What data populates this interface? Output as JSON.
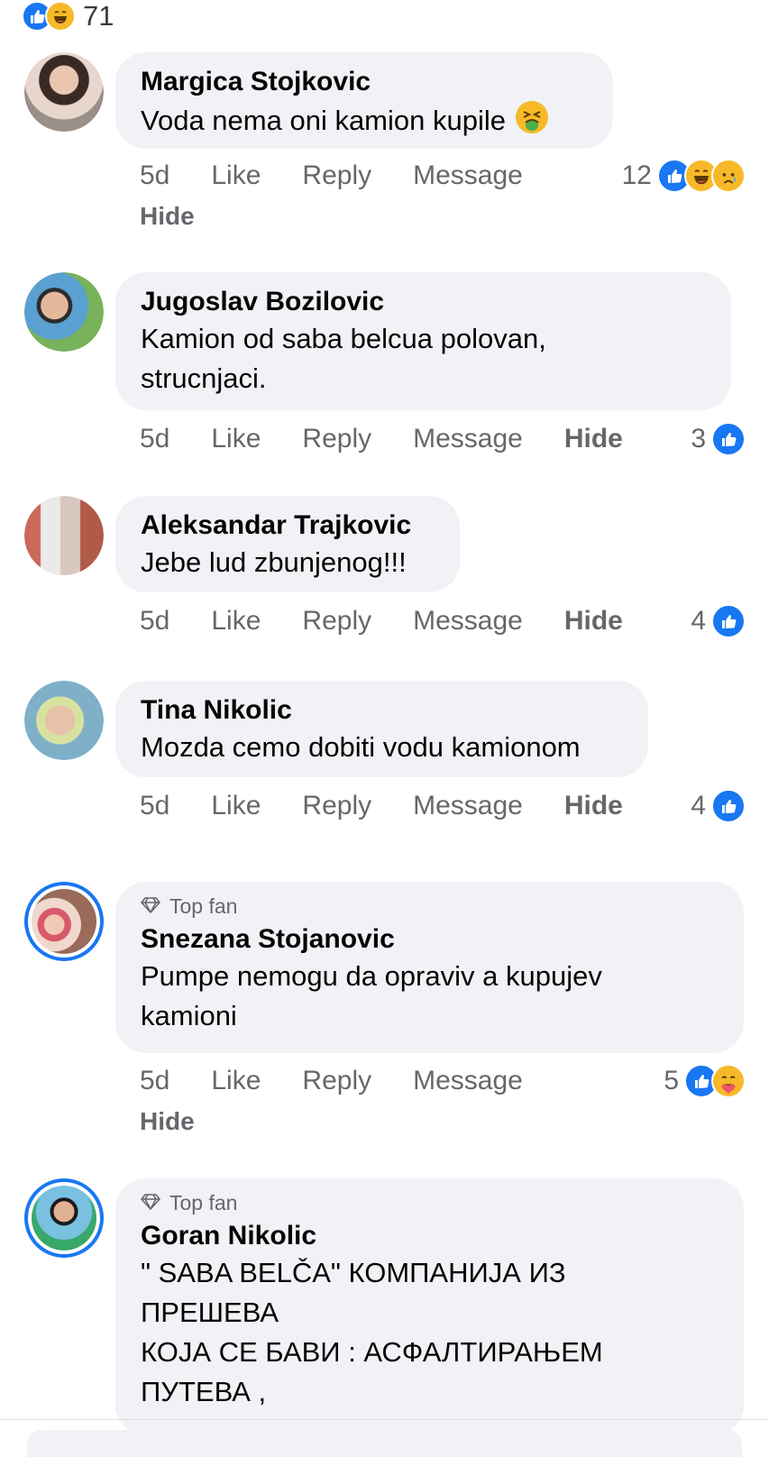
{
  "top": {
    "count": "71",
    "reactions": [
      "like-icon",
      "haha-icon"
    ]
  },
  "comments": [
    {
      "author": "Margica Stojkovic",
      "text": "Voda nema oni kamion kupile",
      "emoji": "tired-face-icon",
      "time": "5d",
      "like": "Like",
      "reply": "Reply",
      "message": "Message",
      "hide": "Hide",
      "reaction_count": "12",
      "reactions": [
        "like-icon",
        "haha-icon",
        "sad-icon"
      ],
      "avatar_color": "#c9a48f"
    },
    {
      "author": "Jugoslav Bozilovic",
      "text": "Kamion od saba belcua polovan,\nstrucnjaci.",
      "time": "5d",
      "like": "Like",
      "reply": "Reply",
      "message": "Message",
      "hide": "Hide",
      "reaction_count": "3",
      "reactions": [
        "like-icon"
      ],
      "avatar_color": "#7fb0d8"
    },
    {
      "author": "Aleksandar Trajkovic",
      "text": "Jebe lud zbunjenog!!!",
      "time": "5d",
      "like": "Like",
      "reply": "Reply",
      "message": "Message",
      "hide": "Hide",
      "reaction_count": "4",
      "reactions": [
        "like-icon"
      ],
      "avatar_color": "#b98a7a"
    },
    {
      "author": "Tina Nikolic",
      "text": "Mozda cemo dobiti vodu kamionom",
      "time": "5d",
      "like": "Like",
      "reply": "Reply",
      "message": "Message",
      "hide": "Hide",
      "reaction_count": "4",
      "reactions": [
        "like-icon"
      ],
      "avatar_color": "#8fb3c0"
    },
    {
      "badge": "Top fan",
      "author": "Snezana Stojanovic",
      "text": "Pumpe nemogu da opraviv a kupujev\nkamioni",
      "time": "5d",
      "like": "Like",
      "reply": "Reply",
      "message": "Message",
      "hide": "Hide",
      "reaction_count": "5",
      "reactions": [
        "like-icon",
        "care-icon"
      ],
      "avatar_color": "#d9a0a0"
    },
    {
      "badge": "Top fan",
      "author": "Goran Nikolic",
      "text": "\" SABA BELČA\" КОМПАНИЈА ИЗ\nПРЕШЕВА\nКОЈА СЕ БАВИ : АСФАЛТИРАЊЕМ\nПУТЕВА ,",
      "avatar_color": "#6aa86a"
    }
  ],
  "colors": {
    "accent": "#1877f2",
    "bubble": "#f0f2f5",
    "muted": "#65676b"
  }
}
